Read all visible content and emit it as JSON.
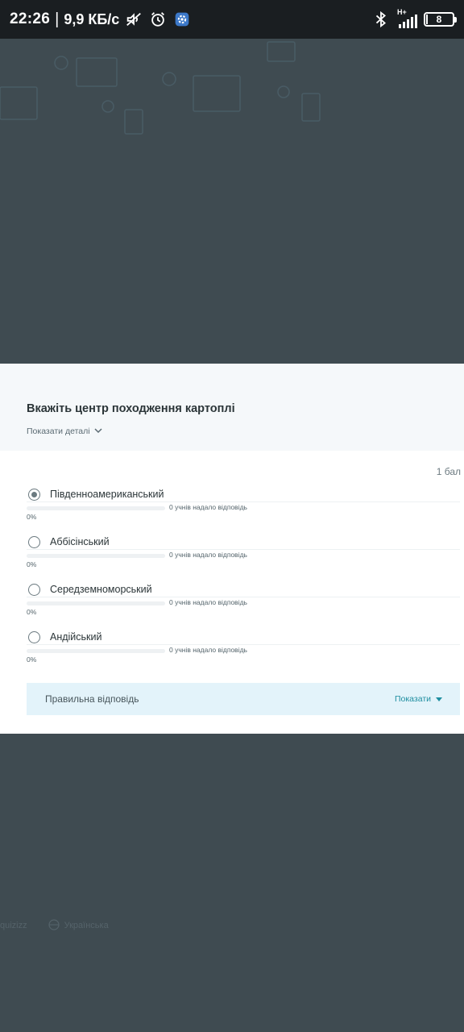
{
  "status_bar": {
    "time": "22:26",
    "separator": "|",
    "speed": "9,9 КБ/с",
    "network_type": "H+",
    "battery": "8"
  },
  "background_footer": {
    "left_text": "quizizz",
    "language": "Українська"
  },
  "question": {
    "title": "Вкажіть центр походження картоплі",
    "details_link": "Показати деталі",
    "points": "1 бал"
  },
  "options": [
    {
      "label": "Південноамериканський",
      "responses": "0 учнів надало відповідь",
      "percent": "0%",
      "fill": 0,
      "selected": true
    },
    {
      "label": "Аббісінський",
      "responses": "0 учнів надало відповідь",
      "percent": "0%",
      "fill": 0,
      "selected": false
    },
    {
      "label": "Середземноморський",
      "responses": "0 учнів надало відповідь",
      "percent": "0%",
      "fill": 0,
      "selected": false
    },
    {
      "label": "Андійський",
      "responses": "0 учнів надало відповідь",
      "percent": "0%",
      "fill": 0,
      "selected": false
    }
  ],
  "correct_answer": {
    "label": "Правильна відповідь",
    "show_button": "Показати"
  },
  "colors": {
    "overlay": "#3f4b51",
    "accent": "#1f8ea0",
    "answer_bg": "#e3f3fa"
  }
}
